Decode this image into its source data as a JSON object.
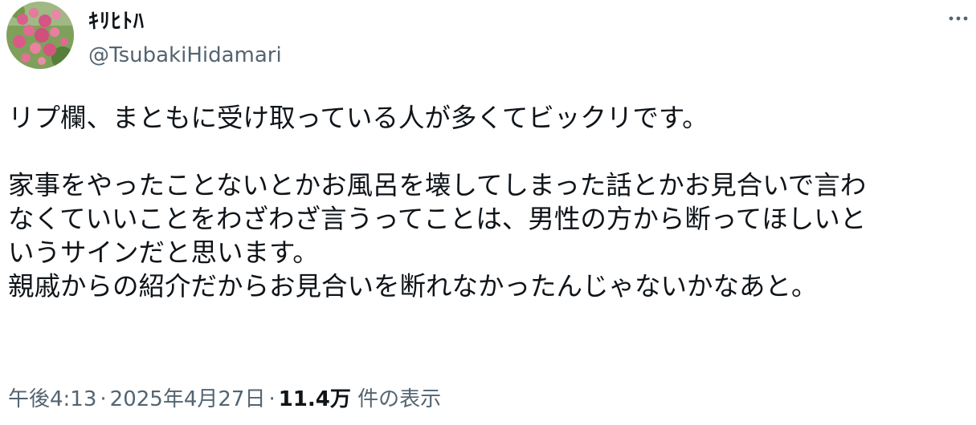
{
  "author": {
    "display_name": "ｷﾘﾋﾄﾊ",
    "handle": "@TsubakiHidamari",
    "avatar_icon": "flower-avatar-icon"
  },
  "menu": {
    "icon": "more-horizontal-icon"
  },
  "tweet": {
    "lines": [
      "リプ欄、まともに受け取っている人が多くてビックリです。",
      "",
      "家事をやったことないとかお風呂を壊してしまった話とかお見合いで言わ",
      "なくていいことをわざわざ言うってことは、男性の方から断ってほしいと",
      "いうサインだと思います。",
      "親戚からの紹介だからお見合いを断れなかったんじゃないかなあと。"
    ]
  },
  "meta": {
    "time": "午後4:13",
    "separator": "·",
    "date": "2025年4月27日",
    "views_count": "11.4万",
    "views_label": "件の表示"
  },
  "colors": {
    "text_primary": "#0f1419",
    "text_secondary": "#536471"
  }
}
